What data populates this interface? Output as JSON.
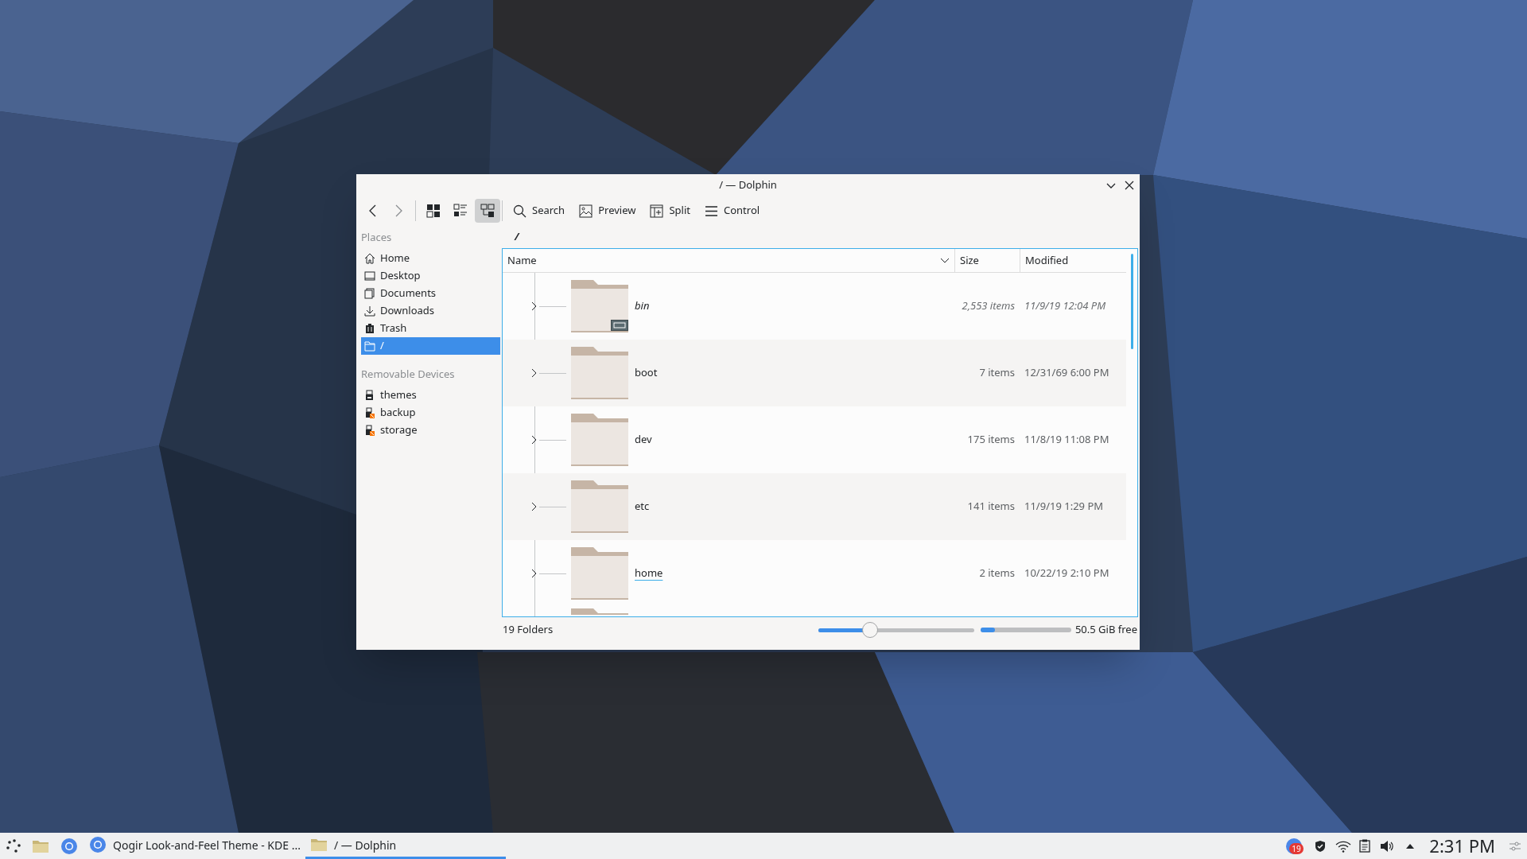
{
  "window": {
    "title": "/ — Dolphin"
  },
  "toolbar": {
    "view_modes": [
      {
        "kind": "icons",
        "selected": false
      },
      {
        "kind": "compact",
        "selected": false
      },
      {
        "kind": "details",
        "selected": true
      }
    ],
    "buttons": [
      {
        "kind": "search",
        "label": "Search"
      },
      {
        "kind": "preview",
        "label": "Preview"
      },
      {
        "kind": "split",
        "label": "Split"
      },
      {
        "kind": "control",
        "label": "Control"
      }
    ]
  },
  "sidebar": {
    "sections": [
      {
        "title": "Places",
        "items": [
          {
            "kind": "home",
            "label": "Home",
            "selected": false
          },
          {
            "kind": "desktop",
            "label": "Desktop",
            "selected": false
          },
          {
            "kind": "documents",
            "label": "Documents",
            "selected": false
          },
          {
            "kind": "downloads",
            "label": "Downloads",
            "selected": false
          },
          {
            "kind": "trash",
            "label": "Trash",
            "selected": false
          },
          {
            "kind": "folder",
            "label": "/",
            "selected": true
          }
        ]
      },
      {
        "title": "Removable Devices",
        "items": [
          {
            "kind": "drive",
            "label": "themes",
            "selected": false
          },
          {
            "kind": "drive-unmounted",
            "label": "backup",
            "selected": false
          },
          {
            "kind": "drive-unmounted",
            "label": "storage",
            "selected": false
          }
        ]
      }
    ]
  },
  "location": "/",
  "table": {
    "columns": [
      "Name",
      "Size",
      "Modified"
    ],
    "rows": [
      {
        "name": "bin",
        "size": "2,553 items",
        "modified": "11/9/19 12:04 PM",
        "symlink": true,
        "hovered": false
      },
      {
        "name": "boot",
        "size": "7 items",
        "modified": "12/31/69 6:00 PM",
        "symlink": false,
        "hovered": false
      },
      {
        "name": "dev",
        "size": "175 items",
        "modified": "11/8/19 11:08 PM",
        "symlink": false,
        "hovered": false
      },
      {
        "name": "etc",
        "size": "141 items",
        "modified": "11/9/19 1:29 PM",
        "symlink": false,
        "hovered": false
      },
      {
        "name": "home",
        "size": "2 items",
        "modified": "10/22/19 2:10 PM",
        "symlink": false,
        "hovered": true
      }
    ]
  },
  "status_bar": {
    "text": "19 Folders",
    "zoom": {
      "level": 0.33
    },
    "disk": {
      "level": 0.16
    },
    "free": "50.5 GiB free"
  },
  "taskbar": {
    "tasks": [
      {
        "kind": "browser",
        "label": "Qogir Look-and-Feel Theme - KDE ...",
        "selected": false
      },
      {
        "kind": "folder",
        "label": "/ — Dolphin",
        "selected": true
      }
    ],
    "badge": "19",
    "clock": "2:31 PM"
  }
}
